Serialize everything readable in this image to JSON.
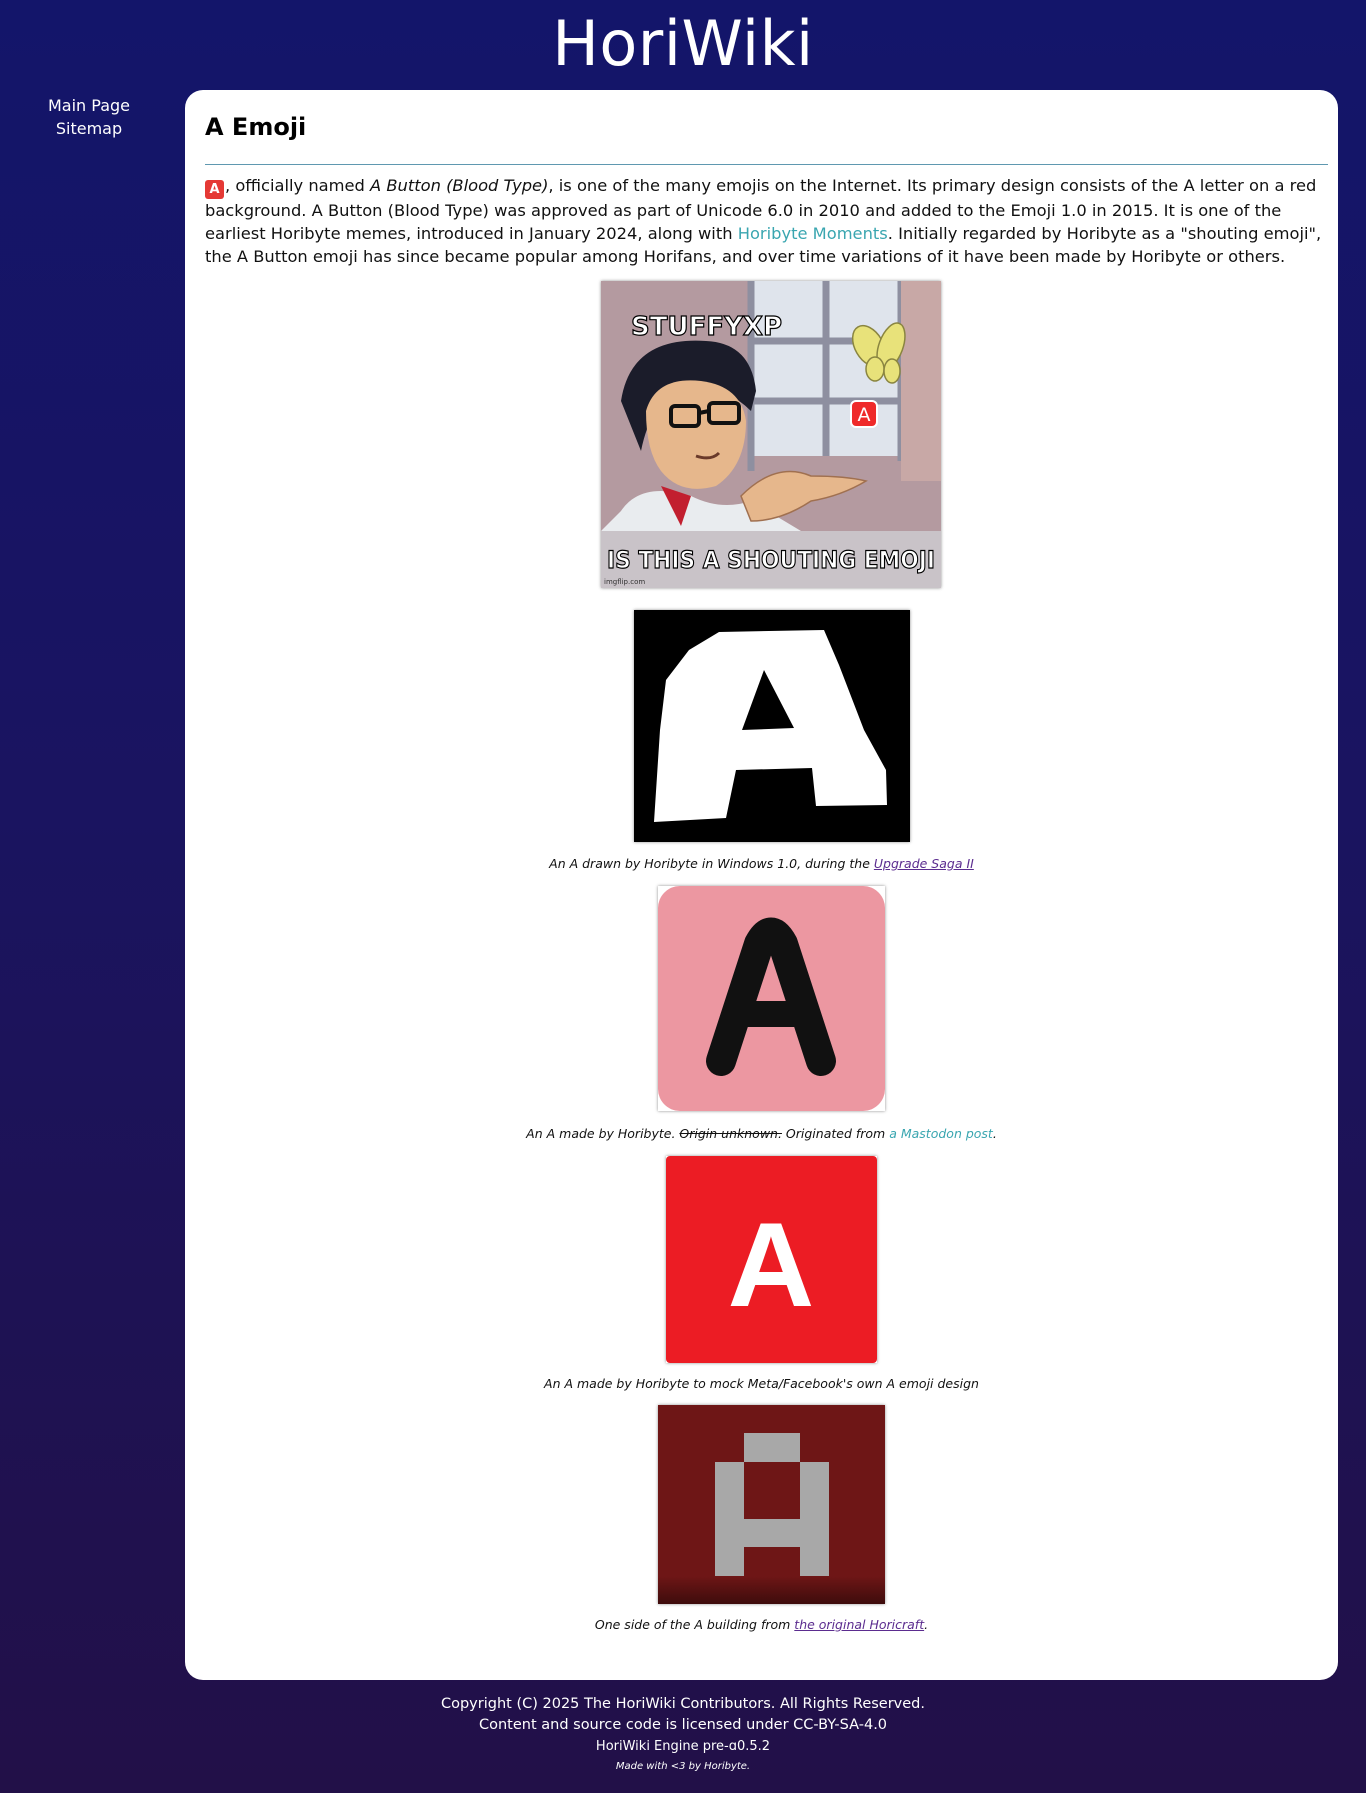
{
  "site": {
    "title": "HoriWiki"
  },
  "nav": {
    "items": [
      {
        "label": "Main Page"
      },
      {
        "label": "Sitemap"
      }
    ]
  },
  "article": {
    "title": "A Emoji",
    "intro": {
      "emoji": "A",
      "part1": ", officially named ",
      "name": "A Button (Blood Type)",
      "part2": ", is one of the many emojis on the Internet. Its primary design consists of the A letter on a red background. A Button (Blood Type) was approved as part of Unicode 6.0 in 2010 and added to the Emoji 1.0 in 2015. It is one of the earliest Horibyte memes, introduced in January 2024, along with ",
      "link": "Horibyte Moments",
      "part3": ". Initially regarded by Horibyte as a \"shouting emoji\", the A Button emoji has since became popular among Horifans, and over time variations of it have been made by Horibyte or others."
    },
    "meme": {
      "top_text": "STUFFYXP",
      "bottom_text": "IS THIS A SHOUTING EMOJI",
      "emoji": "A",
      "watermark": "imgflip.com"
    },
    "figures": [
      {
        "glyph": "A",
        "caption_text": "An A drawn by Horibyte in Windows 1.0, during the ",
        "caption_link": "Upgrade Saga II",
        "caption_after": ""
      },
      {
        "glyph": "A",
        "caption_text": "An A made by Horibyte. ",
        "caption_strike": "Origin unknown.",
        "caption_mid": " Originated from ",
        "caption_link": "a Mastodon post",
        "caption_after": "."
      },
      {
        "glyph": "A",
        "caption_text": "An A made by Horibyte to mock Meta/Facebook's own A emoji design"
      },
      {
        "glyph": "A",
        "caption_text": "One side of the A building from ",
        "caption_link": "the original Horicraft",
        "caption_after": "."
      }
    ]
  },
  "footer": {
    "copyright": "Copyright (C) 2025 The HoriWiki Contributors. All Rights Reserved.",
    "license": "Content and source code is licensed under CC-BY-SA-4.0",
    "engine": "HoriWiki Engine pre-ɑ0.5.2",
    "made_with": "Made with <3 by Horibyte."
  },
  "colors": {
    "background": "#13156a",
    "link_teal": "#3aa6b0",
    "link_visited": "#5b2c8f",
    "emoji_red": "#e53935",
    "pink_tile": "#ec97a1",
    "red_tile": "#ec1c24",
    "block_dark_red": "#6e1616",
    "block_gray": "#a8a8a8"
  }
}
